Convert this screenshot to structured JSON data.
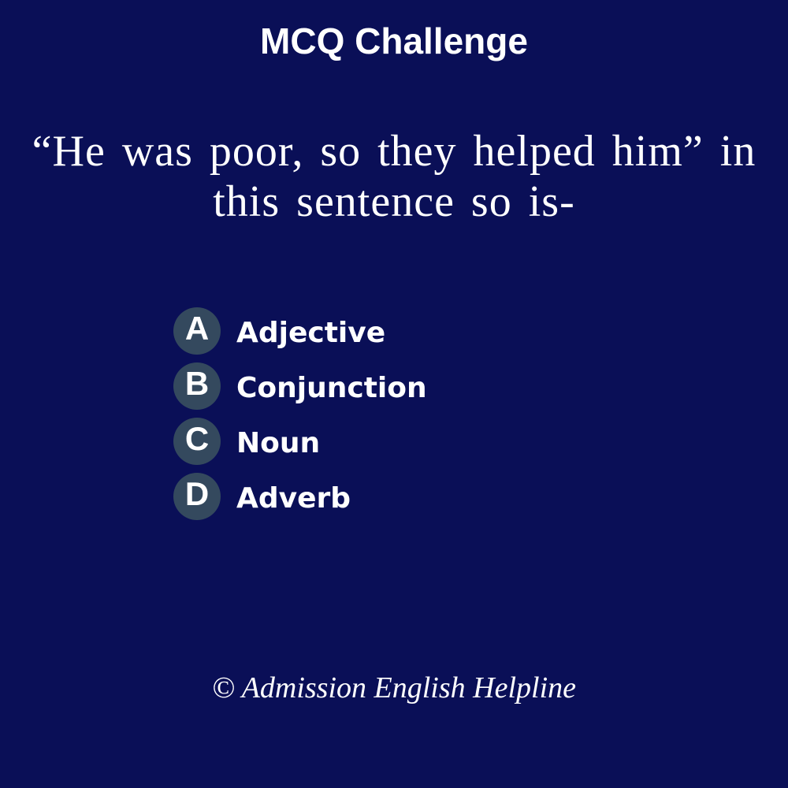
{
  "title": "MCQ Challenge",
  "question": {
    "line1": "“He was poor, so they helped him” in",
    "line2": "this sentence so is-"
  },
  "options": [
    {
      "letter": "A",
      "label": "Adjective"
    },
    {
      "letter": "B",
      "label": "Conjunction"
    },
    {
      "letter": "C",
      "label": "Noun"
    },
    {
      "letter": "D",
      "label": "Adverb"
    }
  ],
  "footer": "© Admission English Helpline",
  "colors": {
    "background": "#0a0f57",
    "badge": "#34495e",
    "text": "#ffffff"
  }
}
